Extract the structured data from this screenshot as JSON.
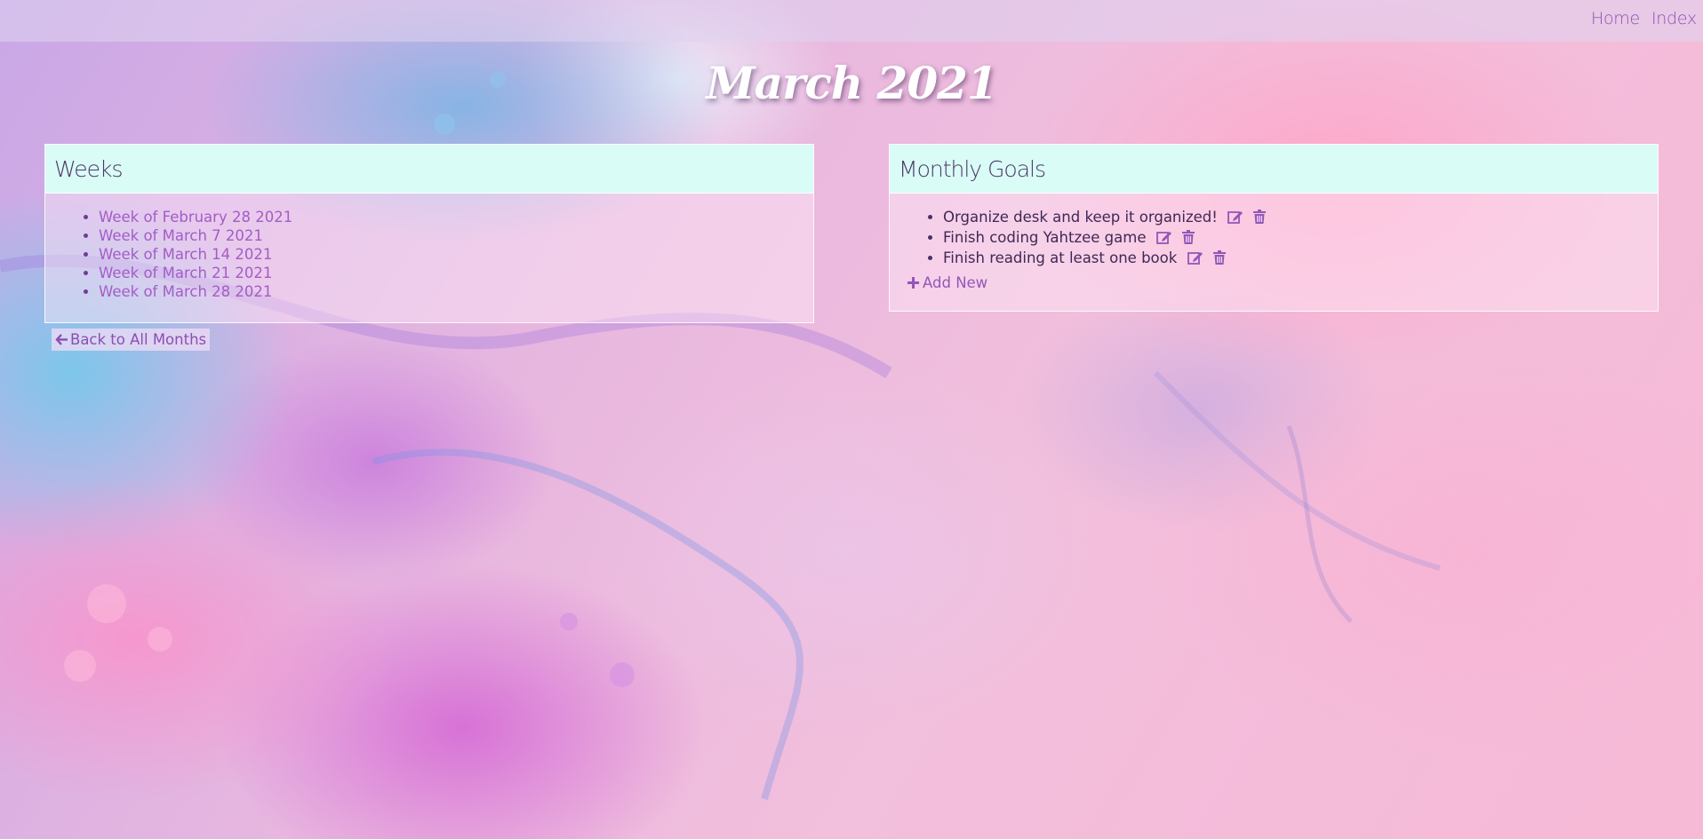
{
  "nav": {
    "home_label": "Home",
    "index_label": "Index"
  },
  "page": {
    "title": "March 2021"
  },
  "weeks_card": {
    "title": "Weeks",
    "items": [
      {
        "label": "Week of February 28 2021"
      },
      {
        "label": "Week of March 7 2021"
      },
      {
        "label": "Week of March 14 2021"
      },
      {
        "label": "Week of March 21 2021"
      },
      {
        "label": "Week of March 28 2021"
      }
    ]
  },
  "goals_card": {
    "title": "Monthly Goals",
    "items": [
      {
        "label": "Organize desk and keep it organized!",
        "edit_icon": "edit-icon",
        "delete_icon": "trash-icon"
      },
      {
        "label": "Finish coding Yahtzee game",
        "edit_icon": "edit-icon",
        "delete_icon": "trash-icon"
      },
      {
        "label": "Finish reading at least one book",
        "edit_icon": "edit-icon",
        "delete_icon": "trash-icon"
      }
    ],
    "add_new_label": "Add New",
    "add_new_icon": "plus-icon"
  },
  "back_button": {
    "label": "Back to All Months",
    "icon": "arrow-left-icon"
  },
  "colors": {
    "accent": "#9456b8",
    "header_bg": "#d9fcf6",
    "link": "#a45cc6",
    "text_dark": "#3f2856"
  }
}
